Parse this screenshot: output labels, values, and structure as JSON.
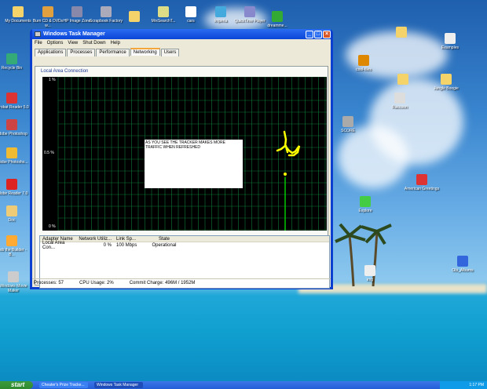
{
  "desktop": {
    "icons": [
      "My Documents",
      "Burn CD & DVDs w...",
      "HP Image Zone",
      "Scrapbook Factory",
      "",
      "MrxSearchT...",
      "cars",
      "Imperia",
      "QuickTime Player",
      "dreamme...",
      "Recycle Bin",
      "Acrobat Reader 5.0",
      "Adobe Photoshop",
      "Adobe Photosho...",
      "Adobe Reader 7.0",
      "Doc",
      "Bob the Builder - B...",
      "Windows Movie Maker",
      "",
      "Examples",
      "cool-files",
      "",
      "Jungle Boogie",
      "Raccoon",
      "SCORE",
      "Explore",
      "American Greetings",
      "Obi_Albums",
      "img"
    ]
  },
  "window": {
    "title": "Windows Task Manager",
    "menu": [
      "File",
      "Options",
      "View",
      "Shut Down",
      "Help"
    ],
    "tabs": [
      "Applications",
      "Processes",
      "Performance",
      "Networking",
      "Users"
    ],
    "active_tab": "Networking",
    "group_label": "Local Area Connection",
    "y_labels": [
      "1 %",
      "0.5 %",
      "0 %"
    ],
    "annotation": "AS YOU SEE THE TRACKER MAKES MORE TRAFFIC WHEN REFRESHED",
    "table": {
      "headers": [
        "Adapter Name",
        "Network Utiliz...",
        "Link Sp...",
        "State"
      ],
      "rows": [
        [
          "Local Area Con...",
          "0 %",
          "100 Mbps",
          "Operational"
        ]
      ]
    },
    "status": {
      "processes": "Processes: 57",
      "cpu": "CPU Usage: 2%",
      "commit": "Commit Charge: 496M / 1952M"
    }
  },
  "taskbar": {
    "start": "start",
    "buttons": [
      "Cheater's Prize Tracke...",
      "Windows Task Manager"
    ],
    "clock": "1:17 PM"
  },
  "colors": {
    "graph_grid": "#0f7a3a",
    "graph_line": "#ffff00",
    "graph_trace": "#00c800",
    "titlebar": "#0a46d8"
  }
}
